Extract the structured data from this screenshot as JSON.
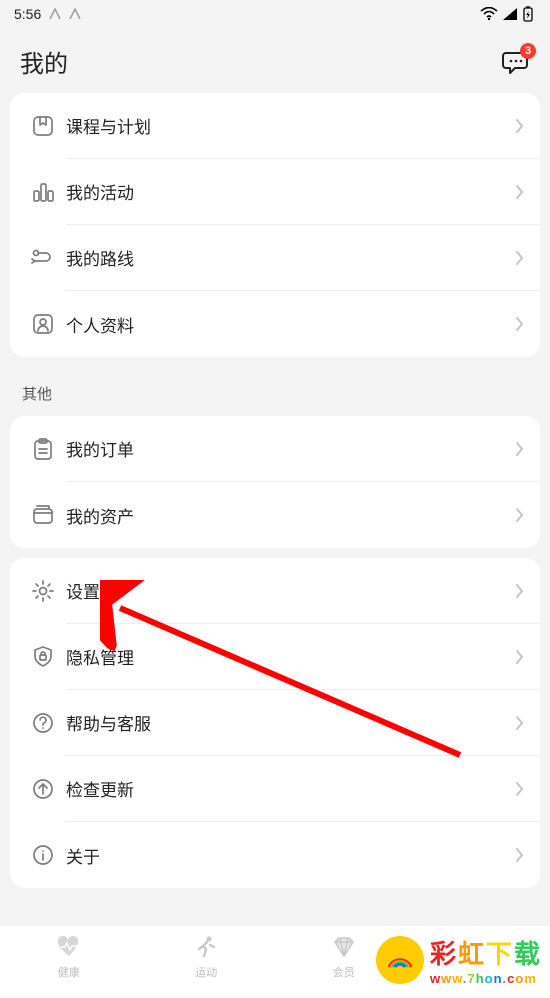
{
  "status": {
    "time": "5:56"
  },
  "header": {
    "title": "我的",
    "chat_badge": "3"
  },
  "section1": {
    "items": [
      {
        "label": "课程与计划",
        "icon": "bookmark-card-icon"
      },
      {
        "label": "我的活动",
        "icon": "activity-icon"
      },
      {
        "label": "我的路线",
        "icon": "route-icon"
      },
      {
        "label": "个人资料",
        "icon": "profile-card-icon"
      }
    ]
  },
  "section2": {
    "title": "其他",
    "items": [
      {
        "label": "我的订单",
        "icon": "clipboard-icon"
      },
      {
        "label": "我的资产",
        "icon": "wallet-icon"
      }
    ]
  },
  "section3": {
    "items": [
      {
        "label": "设置",
        "icon": "gear-icon"
      },
      {
        "label": "隐私管理",
        "icon": "lock-shield-icon"
      },
      {
        "label": "帮助与客服",
        "icon": "help-circle-icon"
      },
      {
        "label": "检查更新",
        "icon": "arrow-up-circle-icon"
      },
      {
        "label": "关于",
        "icon": "info-circle-icon"
      }
    ]
  },
  "nav": {
    "items": [
      {
        "label": "健康",
        "icon": "heart-icon"
      },
      {
        "label": "运动",
        "icon": "runner-icon"
      },
      {
        "label": "会员",
        "icon": "diamond-icon"
      }
    ]
  },
  "watermark": {
    "heading": "彩虹下载",
    "url": "www.7hon.com"
  },
  "annotation": {
    "target": "设置",
    "color": "#ff0000"
  }
}
